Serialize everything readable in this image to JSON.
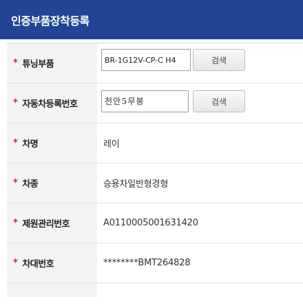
{
  "header": {
    "title": "인증부품장착등록"
  },
  "rows": {
    "tuning": {
      "required": "*",
      "label": "튜닝부품",
      "input_value": "BR-1G12V-CP-C H4",
      "search_label": "검색"
    },
    "plate": {
      "required": "*",
      "label": "자동차등록번호",
      "input_value": "",
      "obscured_text": "천안5무봉",
      "search_label": "검색"
    },
    "car_name": {
      "required": "*",
      "label": "차명",
      "value": "레이"
    },
    "car_type": {
      "required": "*",
      "label": "차종",
      "value": "승용차일반형경형"
    },
    "spec_no": {
      "required": "*",
      "label": "제원관리번호",
      "value": "A0110005001631420"
    },
    "vin": {
      "required": "*",
      "label": "차대번호",
      "value": "********BMT264828"
    }
  }
}
